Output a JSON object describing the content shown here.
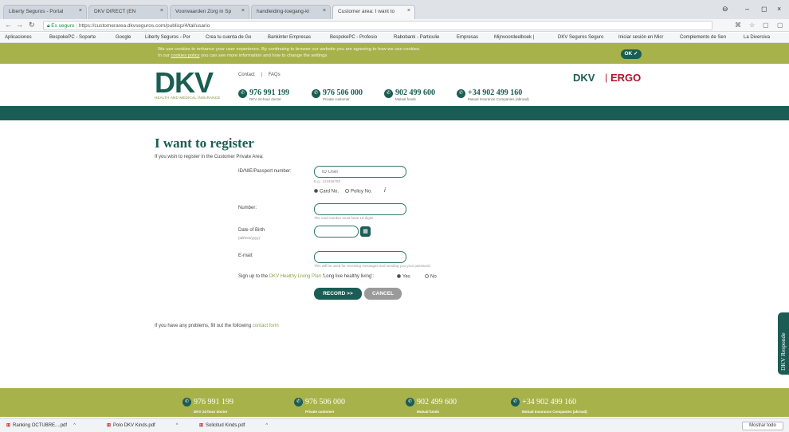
{
  "browser": {
    "tabs": [
      {
        "label": "Liberty Seguros - Portal"
      },
      {
        "label": "DKV DIRECT (EN"
      },
      {
        "label": "Voorwaarden Zorg in Sp"
      },
      {
        "label": "handleiding-toegang-kl"
      },
      {
        "label": "Customer area: I want to"
      }
    ],
    "address": {
      "secure_label": "Es seguro",
      "url": "https://customerarea.dkvseguros.com/publicp/4/tal/usario"
    },
    "bookmarks": [
      "Aplicaciones",
      "BespokePC - Soporte",
      "Google",
      "Liberty Seguros - Por",
      "Crea tu cuenta de Go",
      "Bankinter Empresas",
      "BespokePC - Profesio",
      "Rabobank - Particulie",
      "Empresas",
      "Mijnvoordeelboek |",
      "DKV Seguros Seguro",
      "Iniciar sesión en Micr",
      "Complemento de Sen",
      "La Diversiva"
    ]
  },
  "cookie": {
    "line1": "We use cookies to enhance your user experience. By continuing to browse our website you are agreeing to how we use cookies.",
    "line2_pre": "In our ",
    "line2_link": "cookies policy",
    "line2_post": " you can see more information and how to change the settings",
    "ok_label": "OK ✓"
  },
  "header": {
    "logo": "DKV",
    "logo_tagline": "HEALTH AND MEDICAL INSURANCE",
    "links": {
      "contact": "Contact",
      "sep": "|",
      "faqs": "FAQs"
    },
    "phones": [
      {
        "number": "976 991 199",
        "caption": "DKV 24-hour doctor"
      },
      {
        "number": "976 506 000",
        "caption": "Private customer"
      },
      {
        "number": "902 499 600",
        "caption": "Mutual funds"
      },
      {
        "number": "+34 902 499 160",
        "caption": "Mutual Insurance Companies (abroad)"
      }
    ],
    "brand_dkv": "DKV",
    "brand_sep": "|",
    "brand_ergo": "ERGO"
  },
  "form": {
    "title": "I want to register",
    "intro": "If you wish to register in the Customer Private Area:",
    "id_label": "ID/NIE/Passport number:",
    "id_placeholder": "ID User",
    "id_hint": "E.g.: 12345678Z",
    "radio_card": "Card No.",
    "radio_policy": "Policy No.",
    "info_icon": "i",
    "number_label": "Number:",
    "number_hint": "The card number must have 16 digits",
    "dob_label": "Date of Birth",
    "dob_format": "(dd/mm/yyyy)",
    "email_label": "E-mail:",
    "email_hint": "This will be used for receiving messages and sending you your password",
    "signup_pre": "Sign up to the ",
    "signup_link": "DKV Healthy Living Plan",
    "signup_post": " 'Long live healthy living':",
    "signup_yes": "Yes",
    "signup_no": "No",
    "record_label": "RECORD >>",
    "cancel_label": "CANCEL",
    "problems_pre": "If you have any problems, fill out the following ",
    "problems_link": "contact form"
  },
  "side_tab": "DKV Responde",
  "footer": {
    "phones": [
      {
        "number": "976 991 199",
        "caption": "DKV 24-hour doctor"
      },
      {
        "number": "976 506 000",
        "caption": "Private customer"
      },
      {
        "number": "902 499 600",
        "caption": "Mutual funds"
      },
      {
        "number": "+34 902 499 160",
        "caption": "Mutual Insurance Companies (abroad)"
      }
    ]
  },
  "downloads": {
    "items": [
      "Ranking OCTUBRE....pdf",
      "Polo DKV Kinds.pdf",
      "Solicitud Kinds.pdf"
    ],
    "show_all": "Mostrar todo"
  },
  "colors": {
    "brand_green": "#1b5d55",
    "olive": "#a7b24a",
    "ergo_red": "#b0102a"
  }
}
